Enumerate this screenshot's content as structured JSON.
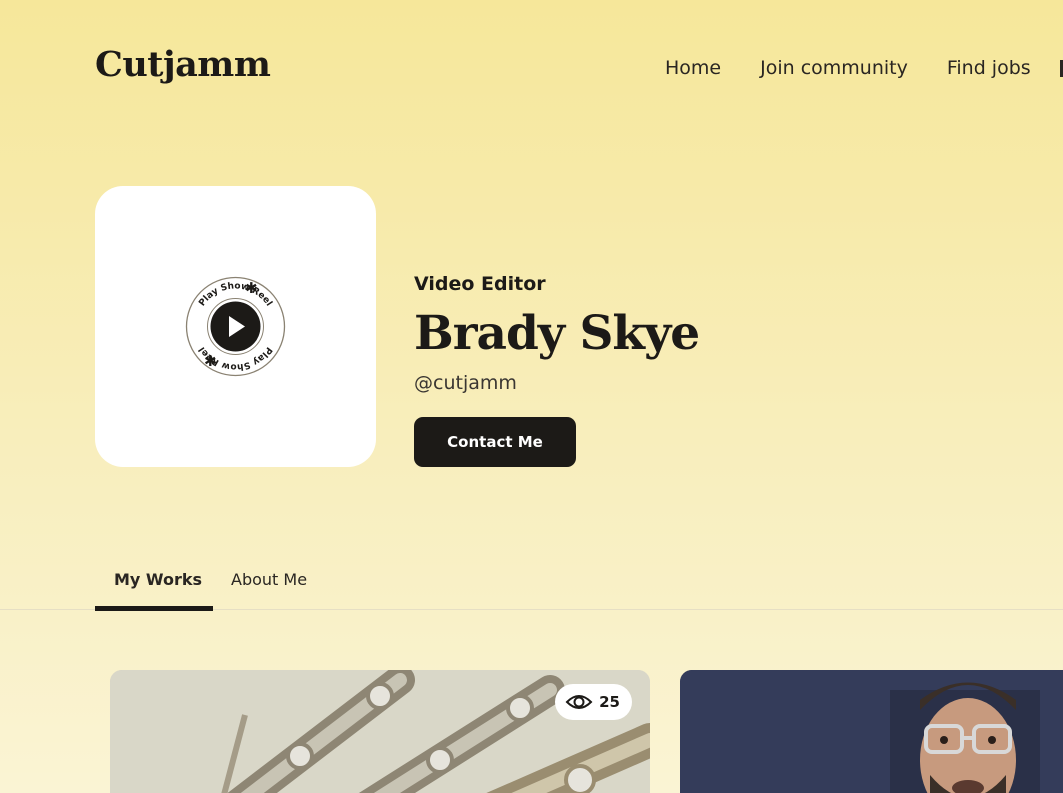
{
  "brand": {
    "logo": "Cutjamm"
  },
  "nav": {
    "home": "Home",
    "community": "Join community",
    "jobs": "Find jobs"
  },
  "reel": {
    "badge_text": "Play Show Reel",
    "icon": "play-icon"
  },
  "profile": {
    "role": "Video Editor",
    "name": "Brady Skye",
    "handle": "@cutjamm",
    "contact_label": "Contact Me"
  },
  "tabs": {
    "works": "My Works",
    "about": "About Me",
    "active": "My Works"
  },
  "works": [
    {
      "views": "25",
      "thumbnail": "robot-hand-image"
    },
    {
      "thumbnail": "man-with-glasses-image"
    }
  ],
  "colors": {
    "accent": "#1c1a17",
    "background_top": "#f6e79a",
    "card": "#ffffff"
  }
}
